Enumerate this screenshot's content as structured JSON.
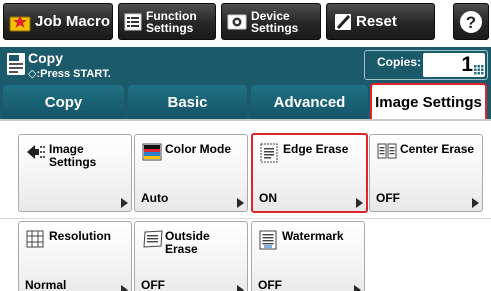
{
  "toolbar": {
    "job_macro_label": "Job Macro",
    "function_settings_label": "Function\nSettings",
    "device_settings_label": "Device\nSettings",
    "reset_label": "Reset",
    "help_label": "?"
  },
  "status": {
    "mode_title": "Copy",
    "message": "◇:Press START.",
    "copies_label": "Copies:",
    "copies_value": "1"
  },
  "tabs": [
    {
      "label": "Copy",
      "selected": false
    },
    {
      "label": "Basic",
      "selected": false
    },
    {
      "label": "Advanced",
      "selected": false
    },
    {
      "label": "Image Settings",
      "selected": true
    }
  ],
  "tiles": [
    {
      "title": "Image\nSettings",
      "value": "",
      "icon": "back-arrow-icon"
    },
    {
      "title": "Color Mode",
      "value": "Auto",
      "icon": "color-mode-icon"
    },
    {
      "title": "Edge Erase",
      "value": "ON",
      "icon": "edge-erase-icon",
      "selected": true
    },
    {
      "title": "Center Erase",
      "value": "OFF",
      "icon": "center-erase-icon"
    },
    {
      "title": "Resolution",
      "value": "Normal",
      "icon": "resolution-grid-icon"
    },
    {
      "title": "Outside\nErase",
      "value": "OFF",
      "icon": "outside-erase-icon"
    },
    {
      "title": "Watermark",
      "value": "OFF",
      "icon": "watermark-icon"
    }
  ],
  "colors": {
    "toolbar_bg": "#262626",
    "status_bg": "#1a5a6b",
    "tab_bg": "#1a6679",
    "selection_red": "#e0242d",
    "macro_star": "#f5c400"
  }
}
